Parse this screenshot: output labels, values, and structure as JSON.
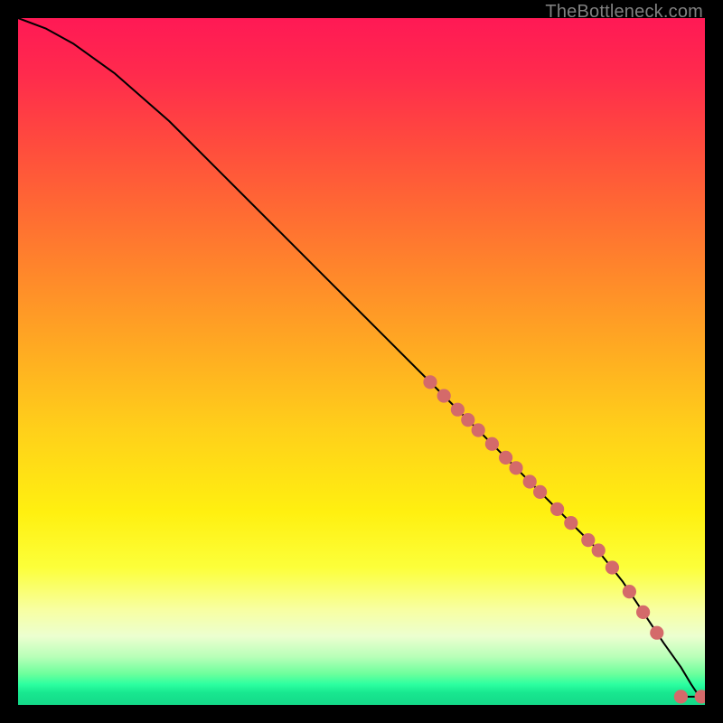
{
  "watermark": "TheBottleneck.com",
  "chart_data": {
    "type": "line",
    "title": "",
    "xlabel": "",
    "ylabel": "",
    "xlim": [
      0,
      100
    ],
    "ylim": [
      0,
      100
    ],
    "grid": false,
    "series": [
      {
        "name": "curve",
        "color": "#000000",
        "x": [
          0,
          4,
          8,
          14,
          22,
          30,
          38,
          46,
          54,
          62,
          70,
          76,
          80,
          84,
          88,
          91,
          94,
          96.5,
          98,
          99,
          100
        ],
        "y": [
          100,
          98.5,
          96.3,
          92,
          85,
          77,
          69,
          61,
          53,
          45,
          37,
          31,
          27,
          23,
          18,
          13.5,
          9,
          5.5,
          3,
          1.5,
          0.6
        ]
      }
    ],
    "points": {
      "name": "markers",
      "color": "#d46a6a",
      "radius_pct": 1.0,
      "x": [
        60,
        62,
        64,
        65.5,
        67,
        69,
        71,
        72.5,
        74.5,
        76,
        78.5,
        80.5,
        83,
        84.5,
        86.5,
        89,
        91,
        93,
        96.5,
        99.5
      ],
      "y": [
        47,
        45,
        43,
        41.5,
        40,
        38,
        36,
        34.5,
        32.5,
        31,
        28.5,
        26.5,
        24,
        22.5,
        20,
        16.5,
        13.5,
        10.5,
        1.2,
        1.2
      ]
    }
  }
}
